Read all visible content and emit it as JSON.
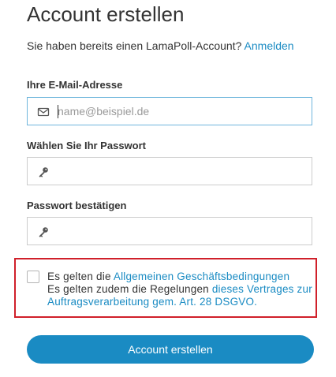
{
  "page": {
    "title": "Account erstellen",
    "login_prompt": "Sie haben bereits einen LamaPoll-Account?",
    "login_link": "Anmelden"
  },
  "form": {
    "email": {
      "label": "Ihre E-Mail-Adresse",
      "placeholder": "name@beispiel.de",
      "value": "",
      "icon": "envelope-icon"
    },
    "password": {
      "label": "Wählen Sie Ihr Passwort",
      "value": "",
      "icon": "key-icon"
    },
    "password_confirm": {
      "label": "Passwort bestätigen",
      "value": "",
      "icon": "key-icon"
    },
    "consent": {
      "checked": false,
      "prefix_1": "Es gelten die ",
      "link_1": "Allgemeinen Geschäftsbedingungen",
      "prefix_2": "Es gelten zudem die Regelungen ",
      "link_2": "dieses Vertrages zur Auftragsverarbeitung gem. Art. 28 DSGVO."
    },
    "submit_label": "Account erstellen"
  },
  "colors": {
    "accent": "#1a8bc3",
    "highlight_border": "#d0202a",
    "focus_border": "#6fb6dc"
  }
}
